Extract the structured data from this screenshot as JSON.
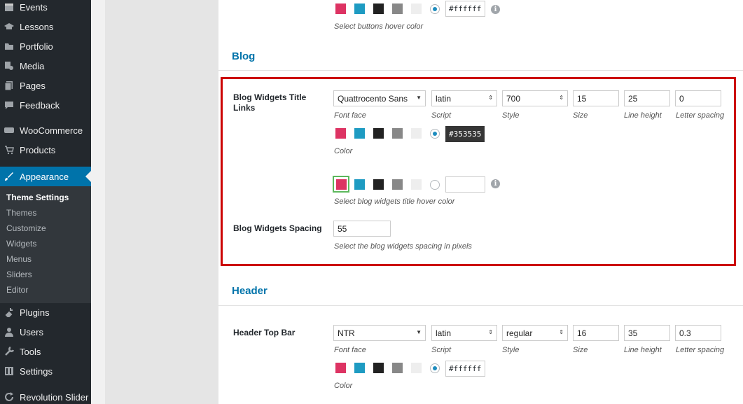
{
  "sidebar": {
    "items": [
      {
        "label": "Events",
        "icon": "calendar-icon"
      },
      {
        "label": "Lessons",
        "icon": "graduation-cap-icon"
      },
      {
        "label": "Portfolio",
        "icon": "folder-icon"
      },
      {
        "label": "Media",
        "icon": "media-icon"
      },
      {
        "label": "Pages",
        "icon": "pages-icon"
      },
      {
        "label": "Feedback",
        "icon": "comment-icon"
      },
      {
        "label": "WooCommerce",
        "icon": "woocommerce-icon"
      },
      {
        "label": "Products",
        "icon": "cart-icon"
      },
      {
        "label": "Appearance",
        "icon": "paintbrush-icon"
      },
      {
        "label": "Plugins",
        "icon": "plugin-icon"
      },
      {
        "label": "Users",
        "icon": "user-icon"
      },
      {
        "label": "Tools",
        "icon": "wrench-icon"
      },
      {
        "label": "Settings",
        "icon": "settings-icon"
      },
      {
        "label": "Revolution Slider",
        "icon": "refresh-icon"
      }
    ],
    "submenu": [
      {
        "label": "Theme Settings"
      },
      {
        "label": "Themes"
      },
      {
        "label": "Customize"
      },
      {
        "label": "Widgets"
      },
      {
        "label": "Menus"
      },
      {
        "label": "Sliders"
      },
      {
        "label": "Editor"
      }
    ]
  },
  "colors": {
    "swatches": [
      "#dd3363",
      "#1e9bc2",
      "#222222",
      "#888888",
      "#eeeeee"
    ],
    "accent": "#0073aa",
    "highlight": "#cc0000"
  },
  "top": {
    "hex": "#ffffff",
    "desc": "Select buttons hover color"
  },
  "blog": {
    "title": "Blog",
    "widgets_title": {
      "label": "Blog Widgets Title Links",
      "font_face": "Quattrocento Sans",
      "script": "latin",
      "style": "700",
      "size": "15",
      "line_height": "25",
      "letter_spacing": "0",
      "font_face_label": "Font face",
      "script_label": "Script",
      "style_label": "Style",
      "size_label": "Size",
      "line_height_label": "Line height",
      "letter_spacing_label": "Letter spacing",
      "color_hex": "#353535",
      "color_label": "Color",
      "hover_hex": "",
      "hover_desc": "Select blog widgets title hover color"
    },
    "spacing": {
      "label": "Blog Widgets Spacing",
      "value": "55",
      "desc": "Select the blog widgets spacing in pixels"
    }
  },
  "header": {
    "title": "Header",
    "top_bar": {
      "label": "Header Top Bar",
      "font_face": "NTR",
      "script": "latin",
      "style": "regular",
      "size": "16",
      "line_height": "35",
      "letter_spacing": "0.3",
      "font_face_label": "Font face",
      "script_label": "Script",
      "style_label": "Style",
      "size_label": "Size",
      "line_height_label": "Line height",
      "letter_spacing_label": "Letter spacing",
      "color_hex": "#ffffff",
      "color_label": "Color"
    }
  }
}
